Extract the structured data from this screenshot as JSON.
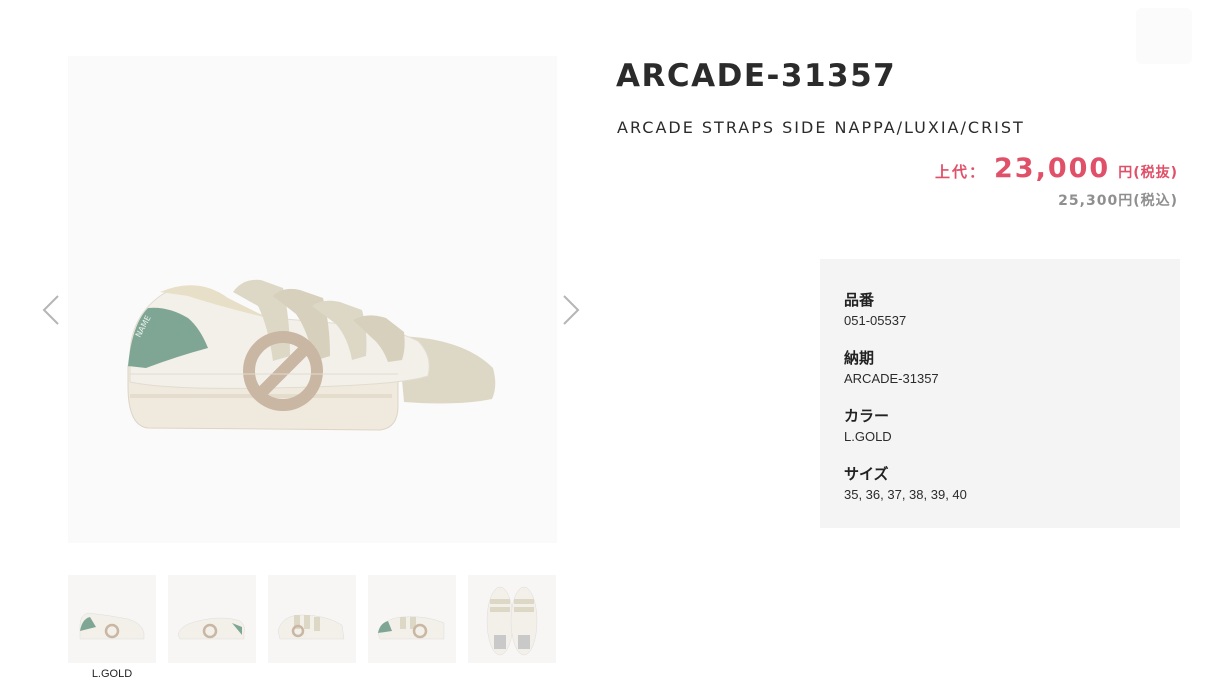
{
  "product": {
    "title": "ARCADE-31357",
    "subtitle": "ARCADE STRAPS SIDE NAPPA/LUXIA/CRIST",
    "price_label": "上代：",
    "price_value": "23,000",
    "price_unit": "円(税抜)",
    "price_tax_included": "25,300円(税込)"
  },
  "gallery": {
    "prev_icon": "chevron-left-icon",
    "next_icon": "chevron-right-icon",
    "thumbnail_label": "L.GOLD"
  },
  "spec": [
    {
      "label": "品番",
      "value": "051-05537"
    },
    {
      "label": "納期",
      "value": "ARCADE-31357"
    },
    {
      "label": "カラー",
      "value": "L.GOLD"
    },
    {
      "label": "サイズ",
      "value": "35, 36, 37, 38, 39, 40"
    }
  ],
  "colors": {
    "price_accent": "#e05068",
    "spec_background": "#f4f4f4",
    "strap_suede": "#ddd8c6",
    "heel_tab": "#7fa694",
    "logo_suede": "#c9b6a3"
  }
}
